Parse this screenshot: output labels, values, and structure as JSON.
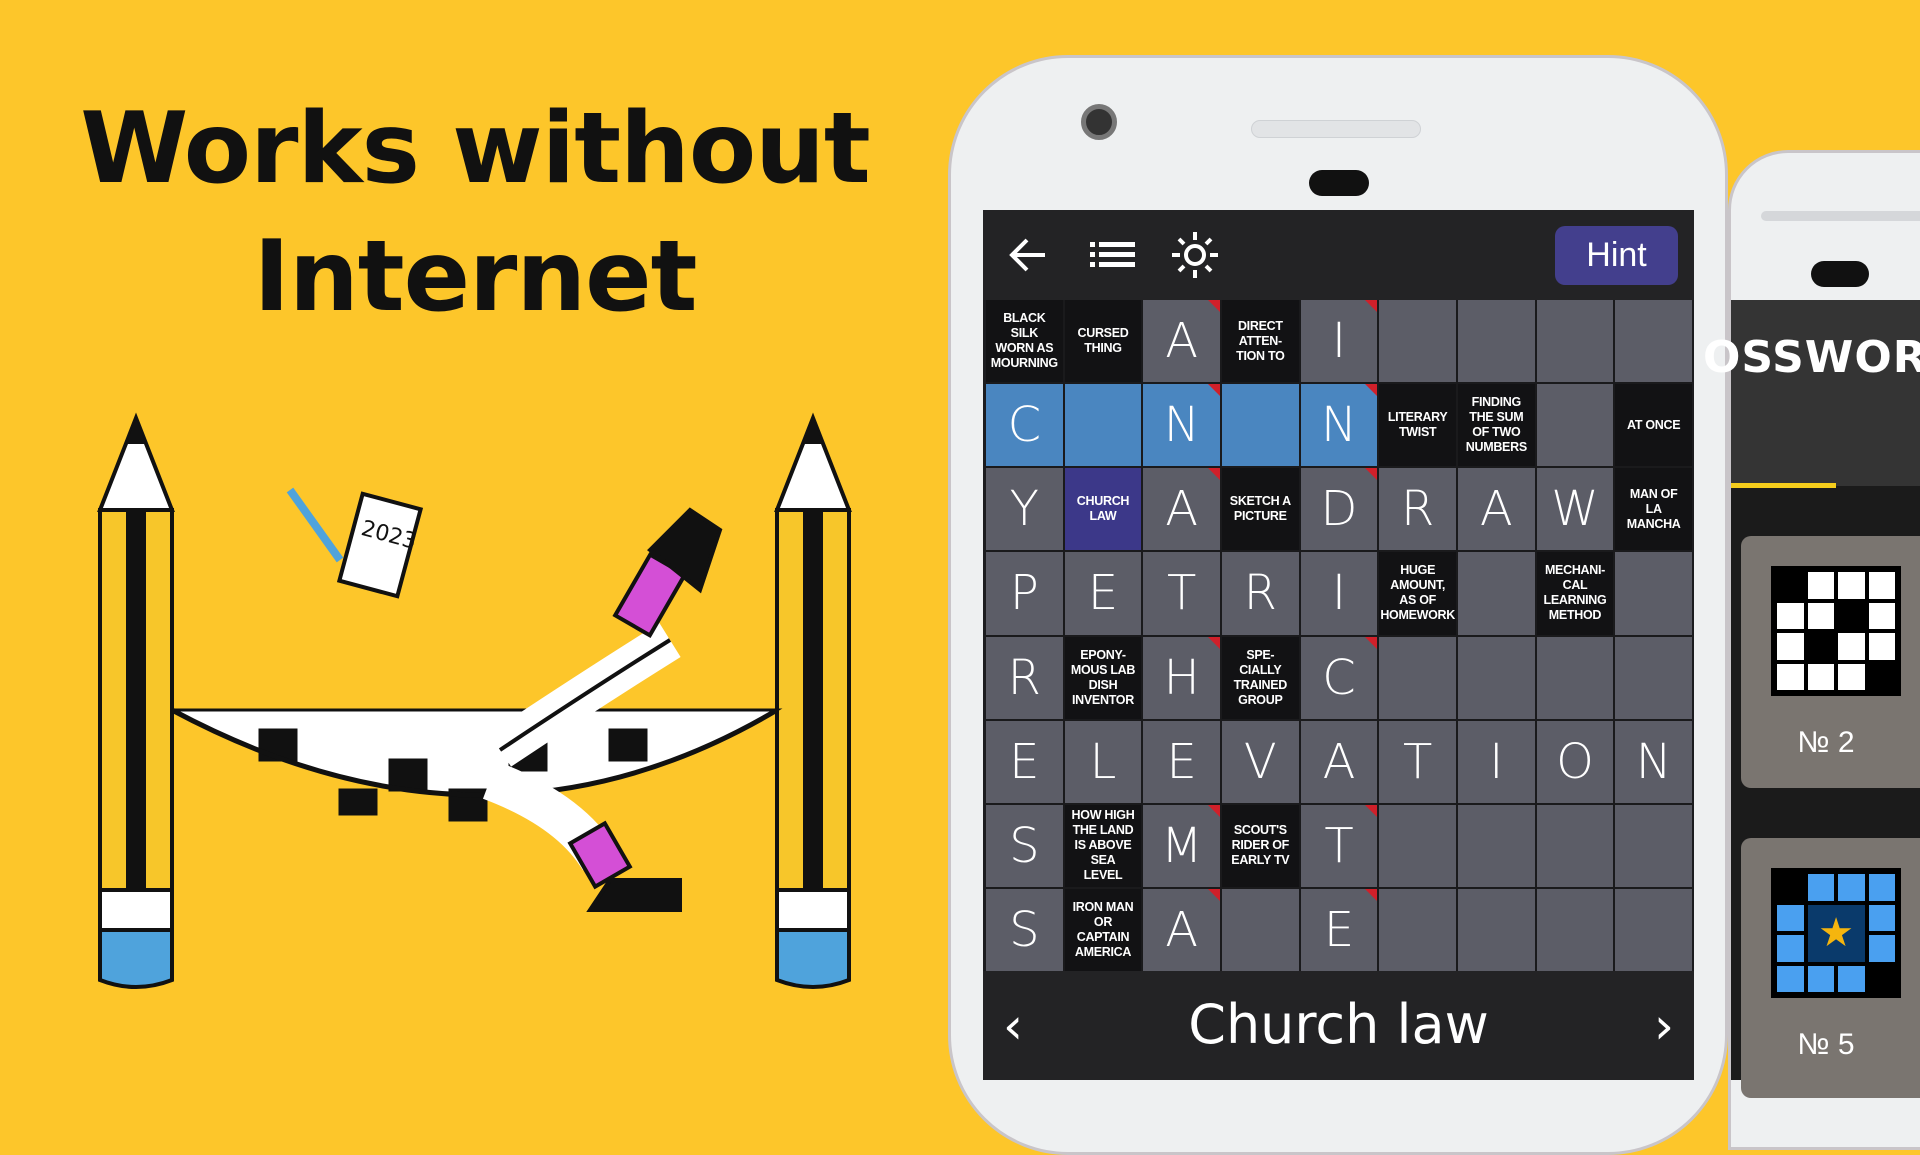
{
  "headline": {
    "line1": "Works without",
    "line2": "Internet"
  },
  "illustration": {
    "paper_year": "2023"
  },
  "colors": {
    "background": "#fdc62a",
    "hint_button": "#433f8d",
    "highlight": "#4a86c0",
    "selected_clue": "#3c3889",
    "cell": "#5c5d67",
    "clue_cell": "#121214"
  },
  "toolbar": {
    "back_icon": "arrow-left-icon",
    "list_icon": "list-icon",
    "theme_icon": "sun-icon",
    "hint_label": "Hint"
  },
  "grid": {
    "rows": [
      [
        {
          "t": "c",
          "v": "BLACK\nSILK\nWORN AS\nMOURNING"
        },
        {
          "t": "c",
          "v": "CURSED\nTHING"
        },
        {
          "t": "l",
          "v": "A",
          "m": true
        },
        {
          "t": "c",
          "v": "DIRECT\nATTEN-\nTION TO"
        },
        {
          "t": "l",
          "v": "I",
          "m": true
        },
        {
          "t": "e"
        },
        {
          "t": "e"
        },
        {
          "t": "e"
        },
        {
          "t": "e"
        }
      ],
      [
        {
          "t": "l",
          "v": "C",
          "h": true
        },
        {
          "t": "e",
          "h": true
        },
        {
          "t": "l",
          "v": "N",
          "h": true,
          "m": true
        },
        {
          "t": "e",
          "h": true
        },
        {
          "t": "l",
          "v": "N",
          "h": true,
          "m": true
        },
        {
          "t": "c",
          "v": "LITERARY\nTWIST"
        },
        {
          "t": "c",
          "v": "FINDING\nTHE SUM\nOF TWO\nNUMBERS"
        },
        {
          "t": "e"
        },
        {
          "t": "c",
          "v": "AT ONCE"
        }
      ],
      [
        {
          "t": "l",
          "v": "Y"
        },
        {
          "t": "c",
          "v": "CHURCH\nLAW",
          "s": true
        },
        {
          "t": "l",
          "v": "A",
          "m": true
        },
        {
          "t": "c",
          "v": "SKETCH A\nPICTURE"
        },
        {
          "t": "l",
          "v": "D",
          "m": true
        },
        {
          "t": "l",
          "v": "R"
        },
        {
          "t": "l",
          "v": "A"
        },
        {
          "t": "l",
          "v": "W"
        },
        {
          "t": "c",
          "v": "MAN OF\nLA\nMANCHA"
        }
      ],
      [
        {
          "t": "l",
          "v": "P"
        },
        {
          "t": "l",
          "v": "E"
        },
        {
          "t": "l",
          "v": "T"
        },
        {
          "t": "l",
          "v": "R"
        },
        {
          "t": "l",
          "v": "I"
        },
        {
          "t": "c",
          "v": "HUGE\nAMOUNT,\nAS OF\nHOMEWORK"
        },
        {
          "t": "e"
        },
        {
          "t": "c",
          "v": "MECHANI-\nCAL\nLEARNING\nMETHOD"
        },
        {
          "t": "e"
        }
      ],
      [
        {
          "t": "l",
          "v": "R"
        },
        {
          "t": "c",
          "v": "EPONY-\nMOUS LAB\nDISH\nINVENTOR"
        },
        {
          "t": "l",
          "v": "H",
          "m": true
        },
        {
          "t": "c",
          "v": "SPE-\nCIALLY\nTRAINED\nGROUP"
        },
        {
          "t": "l",
          "v": "C",
          "m": true
        },
        {
          "t": "e"
        },
        {
          "t": "e"
        },
        {
          "t": "e"
        },
        {
          "t": "e"
        }
      ],
      [
        {
          "t": "l",
          "v": "E"
        },
        {
          "t": "l",
          "v": "L"
        },
        {
          "t": "l",
          "v": "E"
        },
        {
          "t": "l",
          "v": "V"
        },
        {
          "t": "l",
          "v": "A"
        },
        {
          "t": "l",
          "v": "T"
        },
        {
          "t": "l",
          "v": "I"
        },
        {
          "t": "l",
          "v": "O"
        },
        {
          "t": "l",
          "v": "N"
        }
      ],
      [
        {
          "t": "l",
          "v": "S"
        },
        {
          "t": "c",
          "v": "HOW HIGH\nTHE LAND\nIS ABOVE\nSEA\nLEVEL"
        },
        {
          "t": "l",
          "v": "M",
          "m": true
        },
        {
          "t": "c",
          "v": "SCOUT'S\nRIDER OF\nEARLY TV"
        },
        {
          "t": "l",
          "v": "T",
          "m": true
        },
        {
          "t": "e"
        },
        {
          "t": "e"
        },
        {
          "t": "e"
        },
        {
          "t": "e"
        }
      ],
      [
        {
          "t": "l",
          "v": "S"
        },
        {
          "t": "c",
          "v": "IRON MAN\nOR\nCAPTAIN\nAMERICA"
        },
        {
          "t": "l",
          "v": "A",
          "m": true
        },
        {
          "t": "e"
        },
        {
          "t": "l",
          "v": "E",
          "m": true
        },
        {
          "t": "e"
        },
        {
          "t": "e"
        },
        {
          "t": "e"
        },
        {
          "t": "e"
        }
      ]
    ]
  },
  "bottom_bar": {
    "prev": "‹",
    "current_clue": "Church law",
    "next": "›"
  },
  "second_phone": {
    "title": "OSSWOR",
    "cards": [
      {
        "label": "№ 2"
      },
      {
        "label": "№ 5"
      }
    ]
  }
}
